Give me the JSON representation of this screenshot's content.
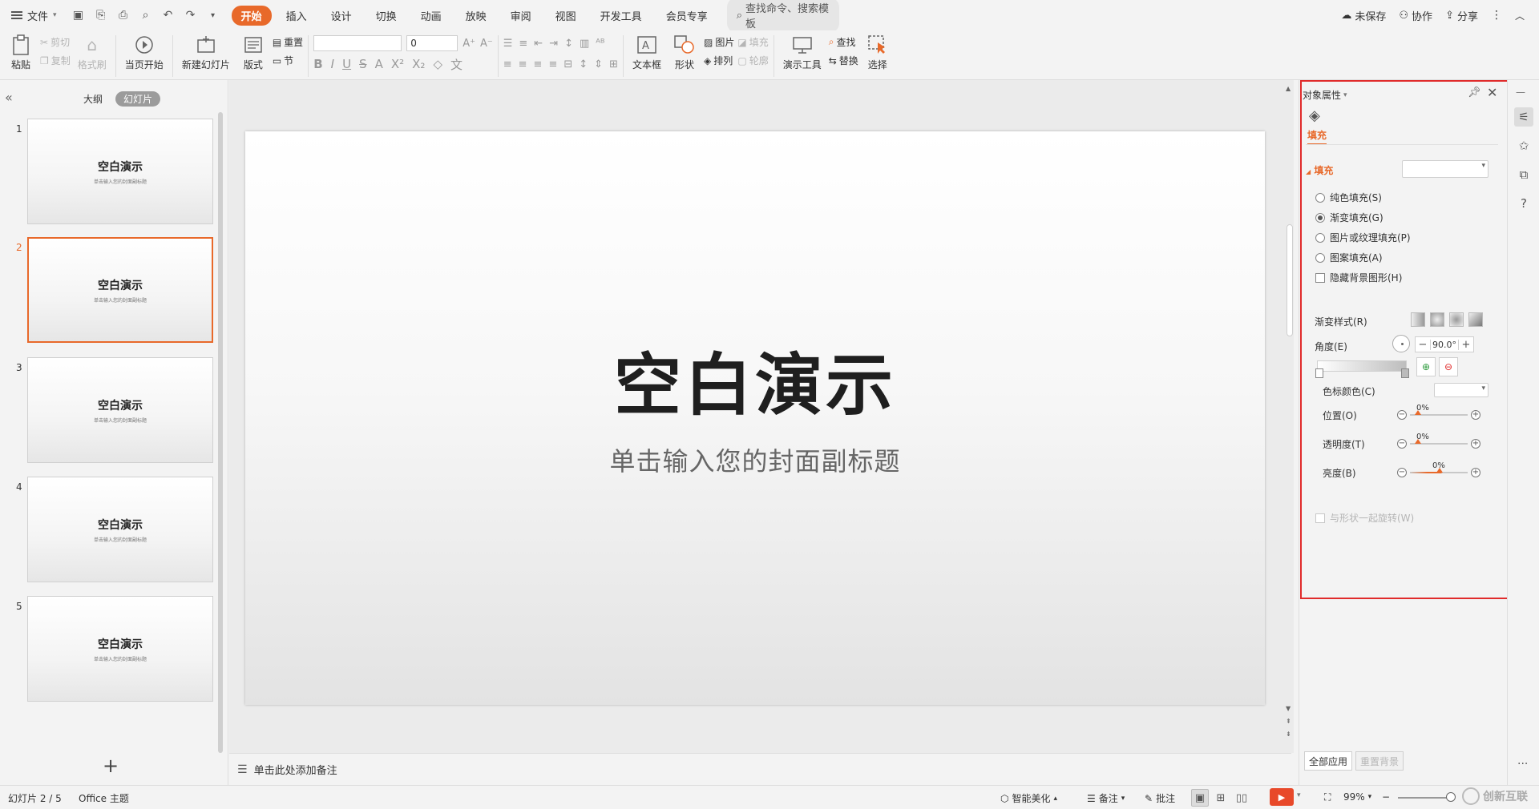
{
  "menubar": {
    "file_label": "文件",
    "tabs": [
      "开始",
      "插入",
      "设计",
      "切换",
      "动画",
      "放映",
      "审阅",
      "视图",
      "开发工具",
      "会员专享"
    ],
    "active_tab": "开始",
    "search_placeholder": "查找命令、搜索模板",
    "right": {
      "unsaved": "未保存",
      "collab": "协作",
      "share": "分享"
    }
  },
  "ribbon": {
    "paste": "粘贴",
    "cut": "剪切",
    "copy": "复制",
    "format_painter": "格式刷",
    "from_current": "当页开始",
    "new_slide": "新建幻灯片",
    "layout": "版式",
    "reset": "重置",
    "section": "节",
    "font_size_value": "0",
    "textbox": "文本框",
    "shape": "形状",
    "picture": "图片",
    "arrange": "排列",
    "fill": "填充",
    "outline": "轮廓",
    "presenter_tools": "演示工具",
    "find": "查找",
    "replace": "替换",
    "select": "选择"
  },
  "leftpanel": {
    "tabs": [
      "大纲",
      "幻灯片"
    ],
    "active_tab": "幻灯片",
    "slides": [
      {
        "num": "1",
        "title": "空白演示",
        "subtitle": "单击输入您的封面副标题"
      },
      {
        "num": "2",
        "title": "空白演示",
        "subtitle": "单击输入您的封面副标题"
      },
      {
        "num": "3",
        "title": "空白演示",
        "subtitle": "单击输入您的封面副标题"
      },
      {
        "num": "4",
        "title": "空白演示",
        "subtitle": "单击输入您的封面副标题"
      },
      {
        "num": "5",
        "title": "空白演示",
        "subtitle": "单击输入您的封面副标题"
      }
    ],
    "active_index": 1,
    "add_label": "+"
  },
  "slide": {
    "title": "空白演示",
    "subtitle": "单击输入您的封面副标题"
  },
  "notes": {
    "placeholder": "单击此处添加备注"
  },
  "props": {
    "header": "对象属性",
    "tab": "填充",
    "section": "填充",
    "options": [
      {
        "label": "纯色填充(S)",
        "selected": false
      },
      {
        "label": "渐变填充(G)",
        "selected": true
      },
      {
        "label": "图片或纹理填充(P)",
        "selected": false
      },
      {
        "label": "图案填充(A)",
        "selected": false
      }
    ],
    "hide_bg": "隐藏背景图形(H)",
    "gradient_style": "渐变样式(R)",
    "angle_label": "角度(E)",
    "angle_value": "90.0°",
    "stop_color": "色标颜色(C)",
    "position_label": "位置(O)",
    "position_value": "0%",
    "transparency_label": "透明度(T)",
    "transparency_value": "0%",
    "brightness_label": "亮度(B)",
    "brightness_value": "0%",
    "rotate_with_shape": "与形状一起旋转(W)",
    "apply_all": "全部应用",
    "reset_bg": "重置背景"
  },
  "statusbar": {
    "slide_info": "幻灯片 2 / 5",
    "theme": "Office 主题",
    "beautify": "智能美化",
    "notes": "备注",
    "comments": "批注",
    "zoom": "99%",
    "watermark": "创新互联"
  },
  "colors": {
    "accent": "#e8692a",
    "highlight_box": "#e02b2b",
    "play": "#e8492a"
  }
}
